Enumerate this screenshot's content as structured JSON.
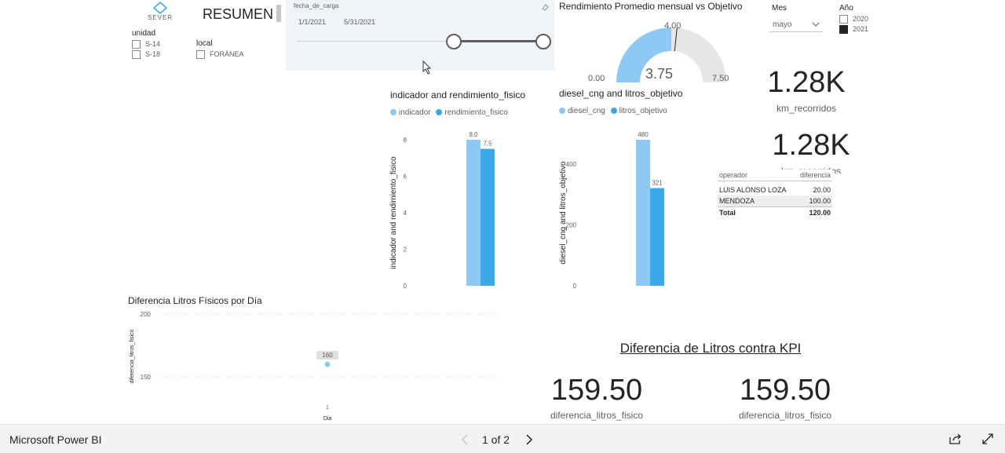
{
  "logo": {
    "name": "SEVER"
  },
  "header": {
    "title": "RESUMEN"
  },
  "slicers": {
    "unidad": {
      "label": "unidad",
      "options": [
        "S-14",
        "S-18"
      ]
    },
    "local": {
      "label": "local",
      "options": [
        "FORÁNEA"
      ]
    },
    "fecha": {
      "label": "fecha_de_carga",
      "start": "1/1/2021",
      "end": "5/31/2021"
    },
    "mes": {
      "label": "Mes",
      "selected": "mayo"
    },
    "anio": {
      "label": "Año",
      "options": [
        {
          "label": "2020",
          "checked": false
        },
        {
          "label": "2021",
          "checked": true
        }
      ]
    }
  },
  "gauge": {
    "title": "Rendimiento Promedio mensual vs Objetivo",
    "min": "0.00",
    "max": "7.50",
    "value": "3.75",
    "target": "4.00",
    "value_num": 3.75,
    "max_num": 7.5,
    "target_num": 4.0
  },
  "kpis": {
    "km1": {
      "value": "1.28K",
      "label": "km_recorridos"
    },
    "km2": {
      "value": "1.28K",
      "label": "km_recorridos"
    },
    "kpi_title": "Diferencia de Litros contra KPI",
    "dif1": {
      "value": "159.50",
      "label": "diferencia_litros_fisico"
    },
    "dif2": {
      "value": "159.50",
      "label": "diferencia_litros_fisico"
    }
  },
  "operators_table": {
    "headers": [
      "operador",
      "diferencia"
    ],
    "rows": [
      [
        "LUIS ALONSO LOZA",
        "20.00"
      ],
      [
        "MENDOZA",
        "100.00"
      ]
    ],
    "total": [
      "Total",
      "120.00"
    ]
  },
  "chart_data": [
    {
      "type": "bar",
      "title": "indicador and rendimiento_fisico",
      "ylabel": "indicador and rendimiento_fisico",
      "categories": [
        ""
      ],
      "series": [
        {
          "name": "indicador",
          "values": [
            8.0
          ]
        },
        {
          "name": "rendimiento_fisico",
          "values": [
            7.5
          ]
        }
      ],
      "data_labels": [
        "8.0",
        "7.5"
      ],
      "yticks": [
        "0",
        "2",
        "4",
        "6",
        "8"
      ],
      "ylim": [
        0,
        8
      ],
      "colors": [
        "#8ec9f5",
        "#3ba9e8"
      ]
    },
    {
      "type": "bar",
      "title": "diesel_cng and litros_objetivo",
      "ylabel": "diesel_cng and litros_objetivo",
      "categories": [
        ""
      ],
      "series": [
        {
          "name": "diesel_cng",
          "values": [
            480
          ]
        },
        {
          "name": "litros_objetivo",
          "values": [
            321
          ]
        }
      ],
      "data_labels": [
        "480",
        "321"
      ],
      "yticks": [
        "0",
        "200",
        "400"
      ],
      "ylim": [
        0,
        480
      ],
      "colors": [
        "#8ec9f5",
        "#3ba9e8"
      ]
    },
    {
      "type": "scatter",
      "title": "Diferencia Litros Físicos por Día",
      "ylabel": "diferencia_litros_fisico",
      "xlabel": "Dia",
      "x": [
        1
      ],
      "y": [
        160
      ],
      "point_labels": [
        "160"
      ],
      "xticks": [
        "1"
      ],
      "yticks": [
        "150",
        "200"
      ],
      "ylim": [
        130,
        200
      ]
    }
  ],
  "footer": {
    "app": "Microsoft Power BI",
    "page": "1 of 2"
  }
}
